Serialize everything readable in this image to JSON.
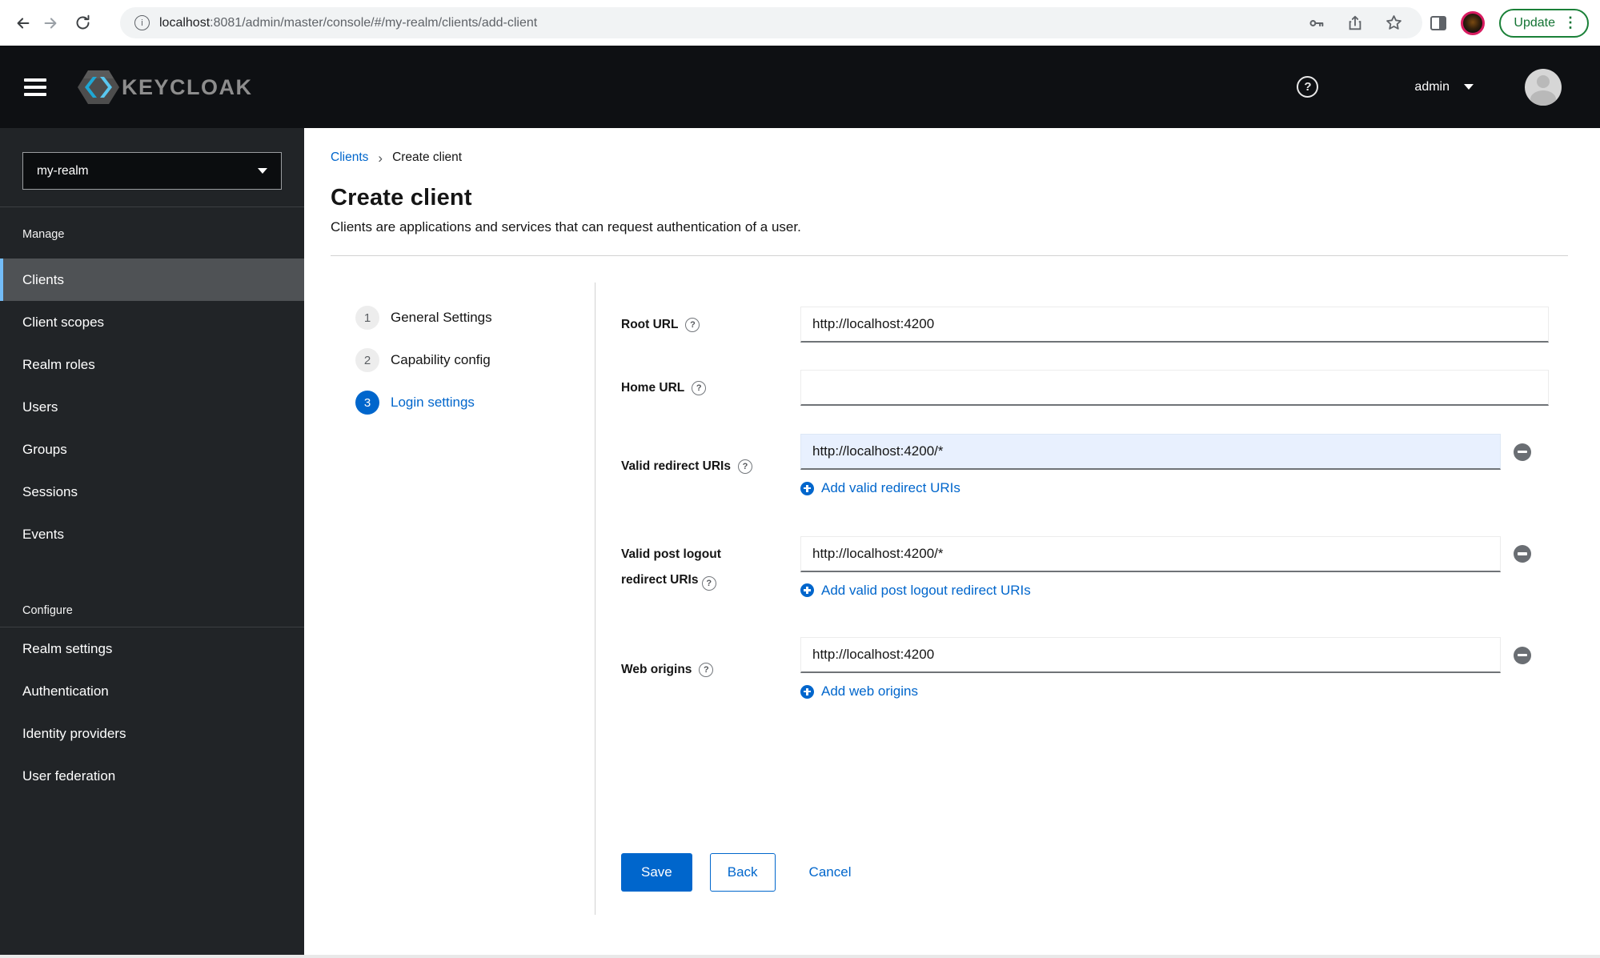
{
  "icons": {
    "help": "?",
    "info": "i",
    "breadcrumb_separator": "›",
    "kebab": "⋮"
  },
  "browser": {
    "url_host": "localhost",
    "url_rest": ":8081/admin/master/console/#/my-realm/clients/add-client",
    "update_label": "Update"
  },
  "header": {
    "brand": "KEYCLOAK",
    "username": "admin"
  },
  "sidebar": {
    "realm_selector": "my-realm",
    "manage": {
      "label": "Manage",
      "items": [
        "Clients",
        "Client scopes",
        "Realm roles",
        "Users",
        "Groups",
        "Sessions",
        "Events"
      ]
    },
    "configure": {
      "label": "Configure",
      "items": [
        "Realm settings",
        "Authentication",
        "Identity providers",
        "User federation"
      ]
    }
  },
  "page": {
    "breadcrumb": [
      "Clients",
      "Create client"
    ],
    "title": "Create client",
    "subtitle": "Clients are applications and services that can request authentication of a user.",
    "steps": [
      {
        "number": "1",
        "label": "General Settings"
      },
      {
        "number": "2",
        "label": "Capability config"
      },
      {
        "number": "3",
        "label": "Login settings"
      }
    ],
    "form": {
      "root_url": {
        "label": "Root URL",
        "value": "http://localhost:4200"
      },
      "home_url": {
        "label": "Home URL",
        "value": ""
      },
      "valid_redirect_uris": {
        "label": "Valid redirect URIs",
        "value": "http://localhost:4200/*",
        "add_label": "Add valid redirect URIs"
      },
      "valid_post_logout": {
        "label": "Valid post logout redirect URIs",
        "value": "http://localhost:4200/*",
        "add_label": "Add valid post logout redirect URIs"
      },
      "web_origins": {
        "label": "Web origins",
        "value": "http://localhost:4200",
        "add_label": "Add web origins"
      }
    },
    "actions": {
      "save": "Save",
      "back": "Back",
      "cancel": "Cancel"
    }
  },
  "colors": {
    "primary_blue": "#0066cc",
    "active_nav_bar": "#73bcf7",
    "sidebar_bg": "#212427",
    "masthead_bg": "#0e1013",
    "highlight_input_bg": "#e8f0fe",
    "update_green": "#137333"
  }
}
